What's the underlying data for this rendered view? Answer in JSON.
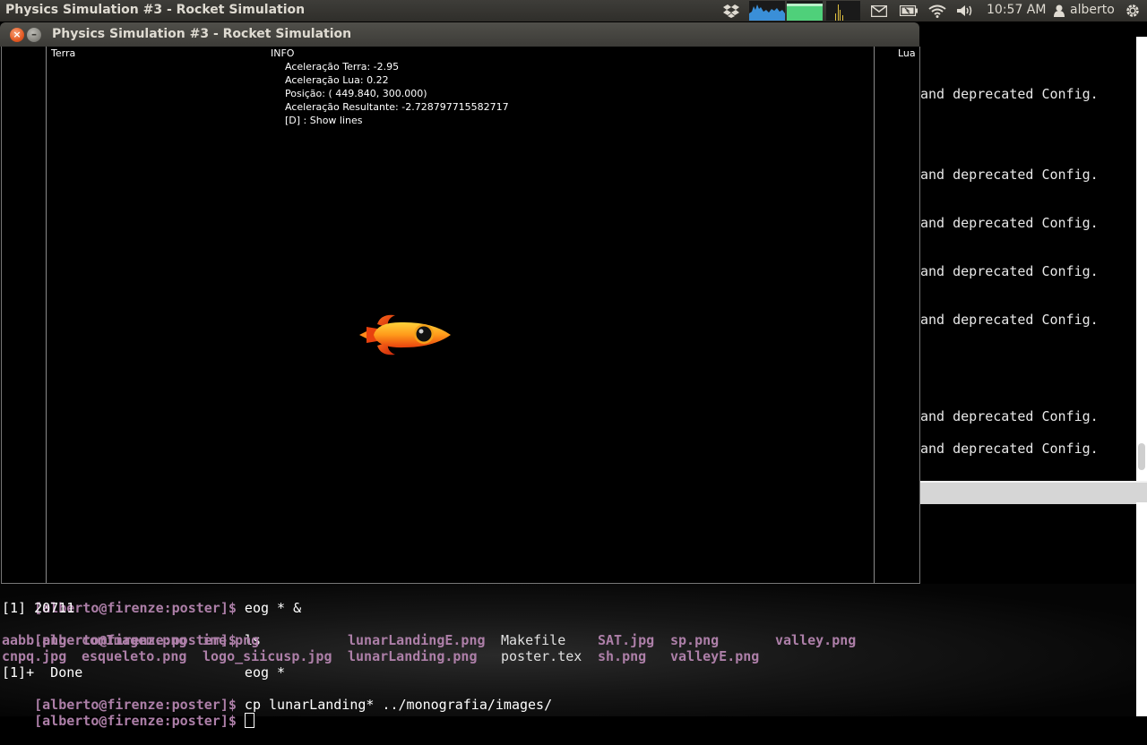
{
  "panel": {
    "title": "Physics Simulation #3 - Rocket Simulation",
    "clock": "10:57 AM",
    "user": "alberto"
  },
  "window": {
    "title": "Physics Simulation #3 - Rocket Simulation",
    "close_label": "×",
    "minimize_label": "–"
  },
  "simulation": {
    "label_left": "Terra",
    "label_info": "INFO",
    "label_right": "Lua",
    "info_lines": [
      "Aceleração Terra: -2.95",
      "Aceleração Lua: 0.22",
      "Posição: ( 449.840,  300.000)",
      "Aceleração Resultante: -2.728797715582717",
      "[D] : Show lines"
    ]
  },
  "background_terminal": {
    "lines": [
      "and deprecated Config.",
      "and deprecated Config.",
      "and deprecated Config.",
      "and deprecated Config.",
      "and deprecated Config.",
      "and deprecated Config.",
      "and deprecated Config."
    ]
  },
  "terminal": {
    "prompt": "[alberto@firenze:poster]$",
    "cmd1": " eog * &",
    "job_line": "[1] 20711",
    "cmd2": " ls",
    "files_row1": [
      "aabb.png",
      "comImagem.png",
      "ime.png",
      "lunarLandingE.png",
      "Makefile",
      "SAT.jpg",
      "sp.png",
      "valley.png"
    ],
    "files_row2": [
      "cnpq.jpg",
      "esqueleto.png",
      "logo_siicusp.jpg",
      "lunarLanding.png",
      "poster.tex",
      "sh.png",
      "valleyE.png"
    ],
    "done_line": "[1]+  Done                    eog *",
    "cmd3": " cp lunarLanding* ../monografia/images/",
    "cmd4": " "
  },
  "icons": [
    "dropbox-icon",
    "system-monitor-icon",
    "mail-icon",
    "battery-icon",
    "wifi-icon",
    "volume-icon",
    "user-icon",
    "gear-icon",
    "rocket-icon",
    "close-icon",
    "minimize-icon"
  ]
}
